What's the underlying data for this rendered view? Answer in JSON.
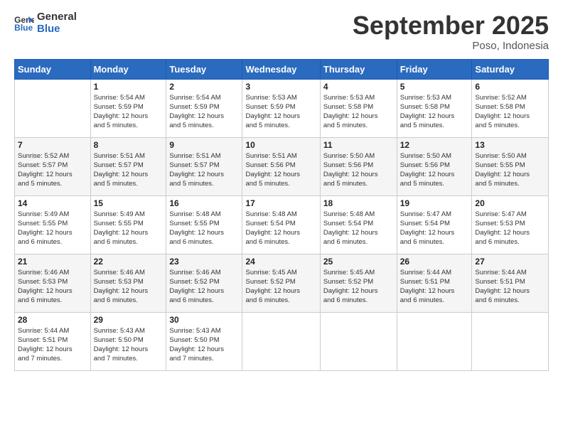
{
  "header": {
    "logo_line1": "General",
    "logo_line2": "Blue",
    "month": "September 2025",
    "location": "Poso, Indonesia"
  },
  "weekdays": [
    "Sunday",
    "Monday",
    "Tuesday",
    "Wednesday",
    "Thursday",
    "Friday",
    "Saturday"
  ],
  "weeks": [
    [
      {
        "day": "",
        "info": ""
      },
      {
        "day": "1",
        "info": "Sunrise: 5:54 AM\nSunset: 5:59 PM\nDaylight: 12 hours\nand 5 minutes."
      },
      {
        "day": "2",
        "info": "Sunrise: 5:54 AM\nSunset: 5:59 PM\nDaylight: 12 hours\nand 5 minutes."
      },
      {
        "day": "3",
        "info": "Sunrise: 5:53 AM\nSunset: 5:59 PM\nDaylight: 12 hours\nand 5 minutes."
      },
      {
        "day": "4",
        "info": "Sunrise: 5:53 AM\nSunset: 5:58 PM\nDaylight: 12 hours\nand 5 minutes."
      },
      {
        "day": "5",
        "info": "Sunrise: 5:53 AM\nSunset: 5:58 PM\nDaylight: 12 hours\nand 5 minutes."
      },
      {
        "day": "6",
        "info": "Sunrise: 5:52 AM\nSunset: 5:58 PM\nDaylight: 12 hours\nand 5 minutes."
      }
    ],
    [
      {
        "day": "7",
        "info": "Sunrise: 5:52 AM\nSunset: 5:57 PM\nDaylight: 12 hours\nand 5 minutes."
      },
      {
        "day": "8",
        "info": "Sunrise: 5:51 AM\nSunset: 5:57 PM\nDaylight: 12 hours\nand 5 minutes."
      },
      {
        "day": "9",
        "info": "Sunrise: 5:51 AM\nSunset: 5:57 PM\nDaylight: 12 hours\nand 5 minutes."
      },
      {
        "day": "10",
        "info": "Sunrise: 5:51 AM\nSunset: 5:56 PM\nDaylight: 12 hours\nand 5 minutes."
      },
      {
        "day": "11",
        "info": "Sunrise: 5:50 AM\nSunset: 5:56 PM\nDaylight: 12 hours\nand 5 minutes."
      },
      {
        "day": "12",
        "info": "Sunrise: 5:50 AM\nSunset: 5:56 PM\nDaylight: 12 hours\nand 5 minutes."
      },
      {
        "day": "13",
        "info": "Sunrise: 5:50 AM\nSunset: 5:55 PM\nDaylight: 12 hours\nand 5 minutes."
      }
    ],
    [
      {
        "day": "14",
        "info": "Sunrise: 5:49 AM\nSunset: 5:55 PM\nDaylight: 12 hours\nand 6 minutes."
      },
      {
        "day": "15",
        "info": "Sunrise: 5:49 AM\nSunset: 5:55 PM\nDaylight: 12 hours\nand 6 minutes."
      },
      {
        "day": "16",
        "info": "Sunrise: 5:48 AM\nSunset: 5:55 PM\nDaylight: 12 hours\nand 6 minutes."
      },
      {
        "day": "17",
        "info": "Sunrise: 5:48 AM\nSunset: 5:54 PM\nDaylight: 12 hours\nand 6 minutes."
      },
      {
        "day": "18",
        "info": "Sunrise: 5:48 AM\nSunset: 5:54 PM\nDaylight: 12 hours\nand 6 minutes."
      },
      {
        "day": "19",
        "info": "Sunrise: 5:47 AM\nSunset: 5:54 PM\nDaylight: 12 hours\nand 6 minutes."
      },
      {
        "day": "20",
        "info": "Sunrise: 5:47 AM\nSunset: 5:53 PM\nDaylight: 12 hours\nand 6 minutes."
      }
    ],
    [
      {
        "day": "21",
        "info": "Sunrise: 5:46 AM\nSunset: 5:53 PM\nDaylight: 12 hours\nand 6 minutes."
      },
      {
        "day": "22",
        "info": "Sunrise: 5:46 AM\nSunset: 5:53 PM\nDaylight: 12 hours\nand 6 minutes."
      },
      {
        "day": "23",
        "info": "Sunrise: 5:46 AM\nSunset: 5:52 PM\nDaylight: 12 hours\nand 6 minutes."
      },
      {
        "day": "24",
        "info": "Sunrise: 5:45 AM\nSunset: 5:52 PM\nDaylight: 12 hours\nand 6 minutes."
      },
      {
        "day": "25",
        "info": "Sunrise: 5:45 AM\nSunset: 5:52 PM\nDaylight: 12 hours\nand 6 minutes."
      },
      {
        "day": "26",
        "info": "Sunrise: 5:44 AM\nSunset: 5:51 PM\nDaylight: 12 hours\nand 6 minutes."
      },
      {
        "day": "27",
        "info": "Sunrise: 5:44 AM\nSunset: 5:51 PM\nDaylight: 12 hours\nand 6 minutes."
      }
    ],
    [
      {
        "day": "28",
        "info": "Sunrise: 5:44 AM\nSunset: 5:51 PM\nDaylight: 12 hours\nand 7 minutes."
      },
      {
        "day": "29",
        "info": "Sunrise: 5:43 AM\nSunset: 5:50 PM\nDaylight: 12 hours\nand 7 minutes."
      },
      {
        "day": "30",
        "info": "Sunrise: 5:43 AM\nSunset: 5:50 PM\nDaylight: 12 hours\nand 7 minutes."
      },
      {
        "day": "",
        "info": ""
      },
      {
        "day": "",
        "info": ""
      },
      {
        "day": "",
        "info": ""
      },
      {
        "day": "",
        "info": ""
      }
    ]
  ]
}
